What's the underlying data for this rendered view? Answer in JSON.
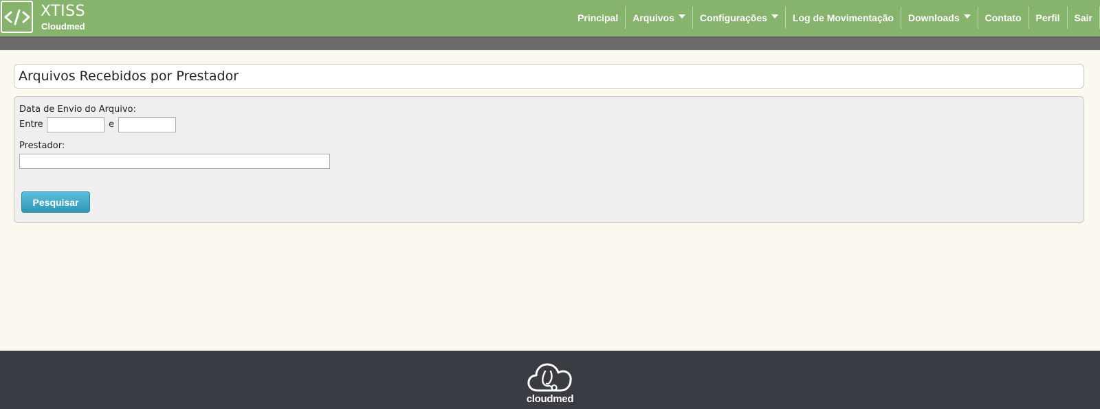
{
  "header": {
    "logo_icon": "code-brackets-icon",
    "brand_title": "XTISS",
    "brand_subtitle": "Cloudmed",
    "nav": [
      {
        "label": "Principal",
        "dropdown": false
      },
      {
        "label": "Arquivos",
        "dropdown": true
      },
      {
        "label": "Configurações",
        "dropdown": true
      },
      {
        "label": "Log de Movimentação",
        "dropdown": false
      },
      {
        "label": "Downloads",
        "dropdown": true
      },
      {
        "label": "Contato",
        "dropdown": false
      },
      {
        "label": "Perfil",
        "dropdown": false
      },
      {
        "label": "Sair",
        "dropdown": false
      }
    ]
  },
  "page": {
    "title": "Arquivos Recebidos por Prestador"
  },
  "form": {
    "date_label": "Data de Envio do Arquivo:",
    "between_label": "Entre",
    "and_label": "e",
    "date_from_value": "",
    "date_to_value": "",
    "provider_label": "Prestador:",
    "provider_value": "",
    "search_button": "Pesquisar"
  },
  "footer": {
    "logo_icon": "cloud-stethoscope-icon",
    "logo_text": "cloudmed"
  },
  "colors": {
    "header_bg": "#87b46d",
    "subbar_bg": "#6a6a6a",
    "page_bg": "#fbf9ef",
    "footer_bg": "#393d43",
    "button_bg": "#49afcd"
  }
}
